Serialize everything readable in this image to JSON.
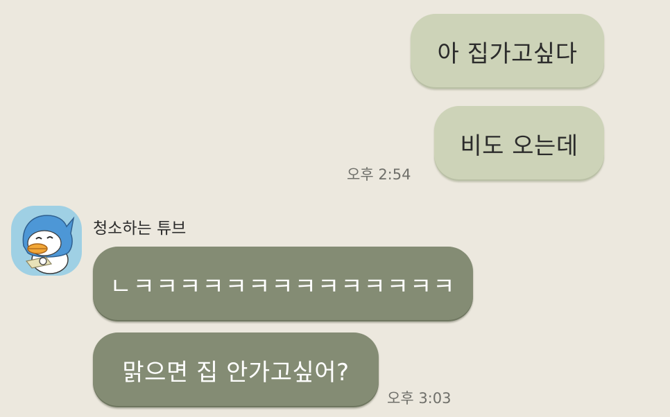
{
  "colors": {
    "background": "#ECE8DE",
    "outgoing_bubble": "#CDD3B8",
    "incoming_bubble": "#848C74",
    "timestamp_text": "#6F6F6A",
    "avatar_background": "#9FD0E4"
  },
  "chat": {
    "outgoing_messages": [
      {
        "text": "아 집가고싶다"
      },
      {
        "text": "비도 오는데",
        "time": "오후 2:54"
      }
    ],
    "incoming_group": {
      "sender_name": "청소하는 튜브",
      "avatar_icon": "tube-duck-character-avatar",
      "messages": [
        {
          "text": "ㄴㅋㅋㅋㅋㅋㅋㅋㅋㅋㅋㅋㅋㅋㅋ"
        },
        {
          "text": "맑으면 집 안가고싶어?",
          "time": "오후 3:03"
        }
      ]
    }
  }
}
